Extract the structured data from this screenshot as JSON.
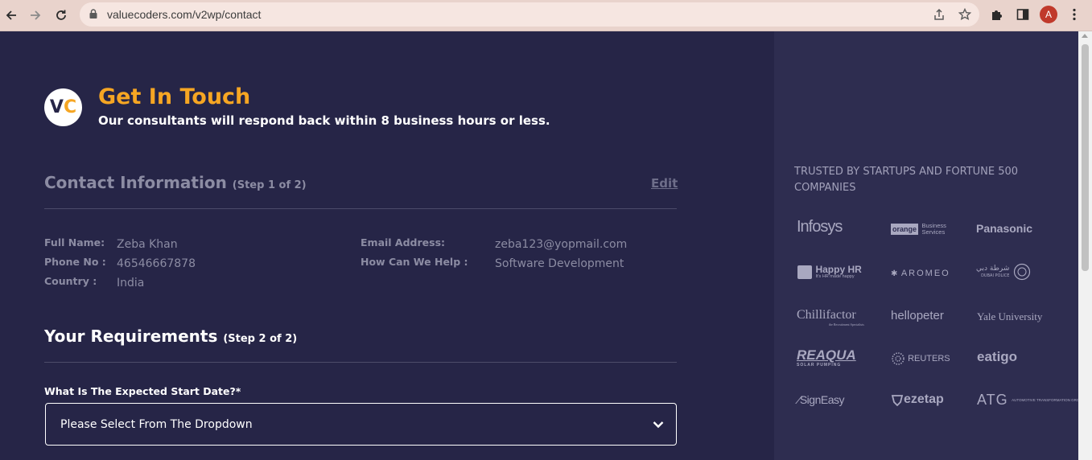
{
  "browser": {
    "url": "valuecoders.com/v2wp/contact",
    "avatar_letter": "A"
  },
  "header": {
    "logo_v": "V",
    "logo_c": "C",
    "title": "Get In Touch",
    "subtitle": "Our consultants will respond back within 8 business hours or less."
  },
  "contact_section": {
    "title": "Contact Information",
    "step": "(Step 1 of 2)",
    "edit": "Edit",
    "fields": {
      "full_name_label": "Full Name:",
      "full_name_value": "Zeba Khan",
      "phone_label": "Phone No :",
      "phone_value": "46546667878",
      "country_label": "Country :",
      "country_value": "India",
      "email_label": "Email Address:",
      "email_value": "zeba123@yopmail.com",
      "help_label": "How Can We Help :",
      "help_value": "Software Development"
    }
  },
  "requirements_section": {
    "title": "Your Requirements",
    "step": "(Step 2 of 2)",
    "start_date_label": "What Is The Expected Start Date?*",
    "start_date_selected": "Please Select From The Dropdown"
  },
  "sidebar": {
    "trusted_heading": "TRUSTED BY STARTUPS AND FORTUNE 500 COMPANIES",
    "brands": {
      "infosys": "Infosys",
      "orange_badge": "orange",
      "orange_line1": "Business",
      "orange_line2": "Services",
      "panasonic": "Panasonic",
      "happyhr": "Happy HR",
      "happyhr_tag": "It's HR made happy",
      "aromeo": "AROMEO",
      "dubai_arabic": "شرطة دبي",
      "dubai_police": "DUBAI POLICE",
      "chillifactor": "Chillifactor",
      "chillifactor_tag": "the Recruitment Specialists",
      "hellopeter": "hellopeter",
      "yale": "Yale University",
      "reaqua": "REAQUA",
      "reaqua_tag": "SOLAR PUMPING",
      "reuters": "REUTERS",
      "eatigo": "eatigo",
      "signeasy": "SignEasy",
      "ezetap": "ezetap",
      "atg": "ATG",
      "atg_tag": "AUTOMOTIVE TRANSFORMATION GROUP"
    }
  },
  "colors": {
    "background": "#262547",
    "sidebar": "#2e2d50",
    "accent": "#f6a623",
    "muted_text": "#8c8ca3"
  }
}
